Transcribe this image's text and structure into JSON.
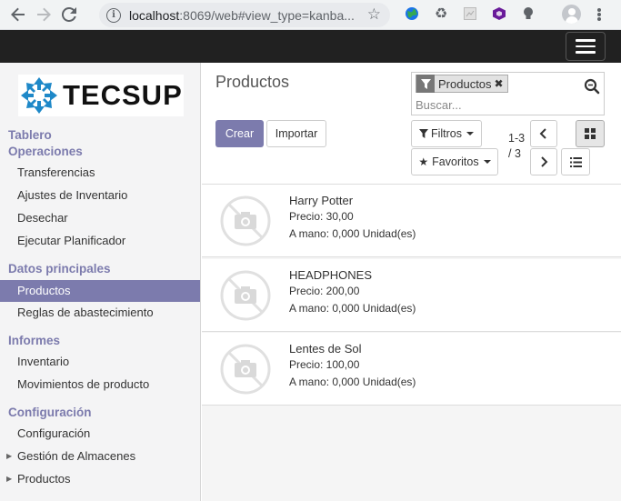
{
  "browser": {
    "url_host": "localhost",
    "url_rest": ":8069/web#view_type=kanba..."
  },
  "logo": {
    "text": "TECSUP"
  },
  "sidebar": {
    "sections": [
      {
        "title": "Tablero"
      },
      {
        "title": "Operaciones",
        "items": [
          "Transferencias",
          "Ajustes de Inventario",
          "Desechar",
          "Ejecutar Planificador"
        ]
      },
      {
        "title": "Datos principales",
        "items": [
          "Productos",
          "Reglas de abastecimiento"
        ]
      },
      {
        "title": "Informes",
        "items": [
          "Inventario",
          "Movimientos de producto"
        ]
      },
      {
        "title": "Configuración",
        "items": [
          "Configuración",
          "Gestión de Almacenes",
          "Productos"
        ]
      }
    ],
    "active_item": "Productos"
  },
  "control_panel": {
    "title": "Productos",
    "create_label": "Crear",
    "import_label": "Importar",
    "search": {
      "facet_label": "Productos",
      "placeholder": "Buscar..."
    },
    "filters_label": "Filtros",
    "favorites_label": "Favoritos",
    "pager": {
      "range": "1-3",
      "total": "/ 3"
    }
  },
  "products": [
    {
      "name": "Harry Potter",
      "price": "Precio: 30,00",
      "stock": "A mano: 0,000 Unidad(es)"
    },
    {
      "name": "HEADPHONES",
      "price": "Precio: 200,00",
      "stock": "A mano: 0,000 Unidad(es)"
    },
    {
      "name": "Lentes de Sol",
      "price": "Precio: 100,00",
      "stock": "A mano: 0,000 Unidad(es)"
    }
  ],
  "colors": {
    "accent": "#7c7bad",
    "topbar": "#212121"
  }
}
